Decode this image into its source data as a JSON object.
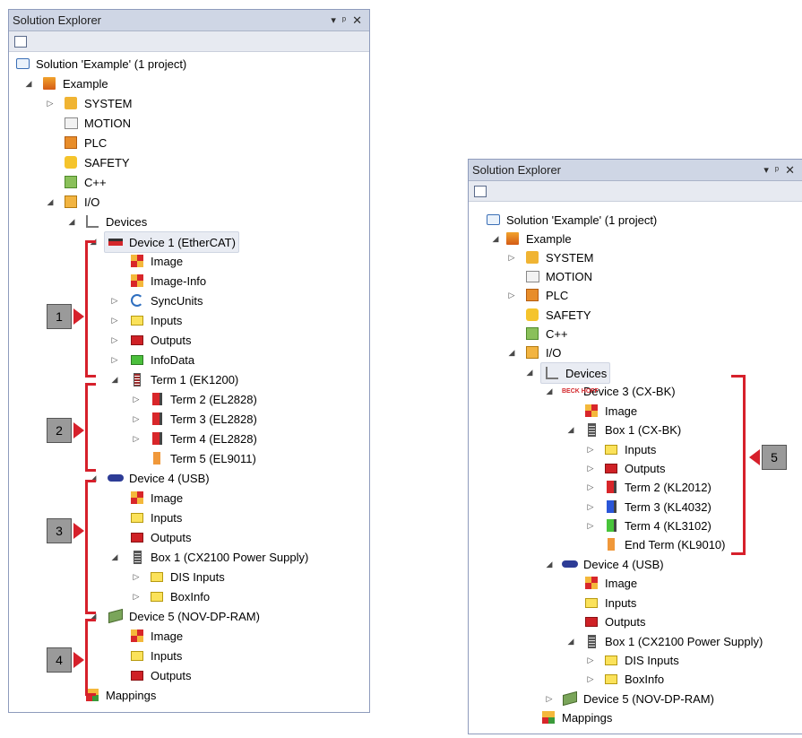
{
  "left": {
    "title": "Solution Explorer",
    "controls": {
      "dropdown": "▾",
      "pin": "ᵖ",
      "close": "✕"
    },
    "nodes": [
      {
        "label": "Solution 'Example' (1 project)"
      },
      {
        "label": "Example"
      },
      {
        "label": "SYSTEM"
      },
      {
        "label": "MOTION"
      },
      {
        "label": "PLC"
      },
      {
        "label": "SAFETY"
      },
      {
        "label": "C++"
      },
      {
        "label": "I/O"
      },
      {
        "label": "Devices"
      },
      {
        "label": "Device 1 (EtherCAT)"
      },
      {
        "label": "Image"
      },
      {
        "label": "Image-Info"
      },
      {
        "label": "SyncUnits"
      },
      {
        "label": "Inputs"
      },
      {
        "label": "Outputs"
      },
      {
        "label": "InfoData"
      },
      {
        "label": "Term 1 (EK1200)"
      },
      {
        "label": "Term 2 (EL2828)"
      },
      {
        "label": "Term 3 (EL2828)"
      },
      {
        "label": "Term 4 (EL2828)"
      },
      {
        "label": "Term 5 (EL9011)"
      },
      {
        "label": "Device 4 (USB)"
      },
      {
        "label": "Image"
      },
      {
        "label": "Inputs"
      },
      {
        "label": "Outputs"
      },
      {
        "label": "Box 1 (CX2100 Power Supply)"
      },
      {
        "label": "DIS Inputs"
      },
      {
        "label": "BoxInfo"
      },
      {
        "label": "Device 5 (NOV-DP-RAM)"
      },
      {
        "label": "Image"
      },
      {
        "label": "Inputs"
      },
      {
        "label": "Outputs"
      },
      {
        "label": "Mappings"
      }
    ],
    "callouts": [
      "1",
      "2",
      "3",
      "4"
    ]
  },
  "right": {
    "title": "Solution Explorer",
    "controls": {
      "dropdown": "▾",
      "pin": "ᵖ",
      "close": "✕"
    },
    "nodes": [
      {
        "label": "Solution 'Example' (1 project)"
      },
      {
        "label": "Example"
      },
      {
        "label": "SYSTEM"
      },
      {
        "label": "MOTION"
      },
      {
        "label": "PLC"
      },
      {
        "label": "SAFETY"
      },
      {
        "label": "C++"
      },
      {
        "label": "I/O"
      },
      {
        "label": "Devices"
      },
      {
        "label": "Device 3 (CX-BK)"
      },
      {
        "label": "Image"
      },
      {
        "label": "Box 1 (CX-BK)"
      },
      {
        "label": "Inputs"
      },
      {
        "label": "Outputs"
      },
      {
        "label": "Term 2 (KL2012)"
      },
      {
        "label": "Term 3 (KL4032)"
      },
      {
        "label": "Term 4 (KL3102)"
      },
      {
        "label": "End Term (KL9010)"
      },
      {
        "label": "Device 4 (USB)"
      },
      {
        "label": "Image"
      },
      {
        "label": "Inputs"
      },
      {
        "label": "Outputs"
      },
      {
        "label": "Box 1 (CX2100 Power Supply)"
      },
      {
        "label": "DIS Inputs"
      },
      {
        "label": "BoxInfo"
      },
      {
        "label": "Device 5 (NOV-DP-RAM)"
      },
      {
        "label": "Mappings"
      }
    ],
    "callouts": [
      "5"
    ],
    "beckhoff_logo": "BECK HOFF"
  },
  "colors": {
    "annotation": "#d6202b",
    "titlebar": "#cfd6e5",
    "selection": "#e9ecf3"
  }
}
